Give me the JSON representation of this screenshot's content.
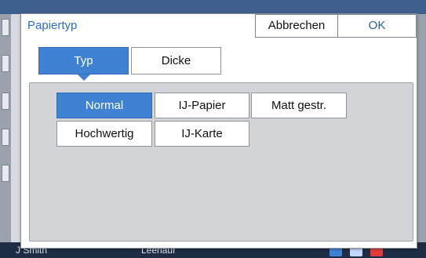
{
  "background": {
    "bottom_left_text": "J Smith",
    "bottom_center_text": "Leerlauf"
  },
  "dialog": {
    "title": "Papiertyp",
    "cancel_label": "Abbrechen",
    "ok_label": "OK"
  },
  "tabs": [
    {
      "label": "Typ",
      "selected": true
    },
    {
      "label": "Dicke",
      "selected": false
    }
  ],
  "options": [
    {
      "label": "Normal",
      "selected": true
    },
    {
      "label": "IJ-Papier",
      "selected": false
    },
    {
      "label": "Matt gestr.",
      "selected": false
    },
    {
      "label": "Hochwertig",
      "selected": false
    },
    {
      "label": "IJ-Karte",
      "selected": false
    }
  ],
  "colors": {
    "accent_blue": "#3f82d4",
    "title_blue": "#2c6fc0",
    "panel_gray": "#d2d4d7"
  },
  "icons": [
    "print-icon",
    "document-icon",
    "check-icon"
  ]
}
